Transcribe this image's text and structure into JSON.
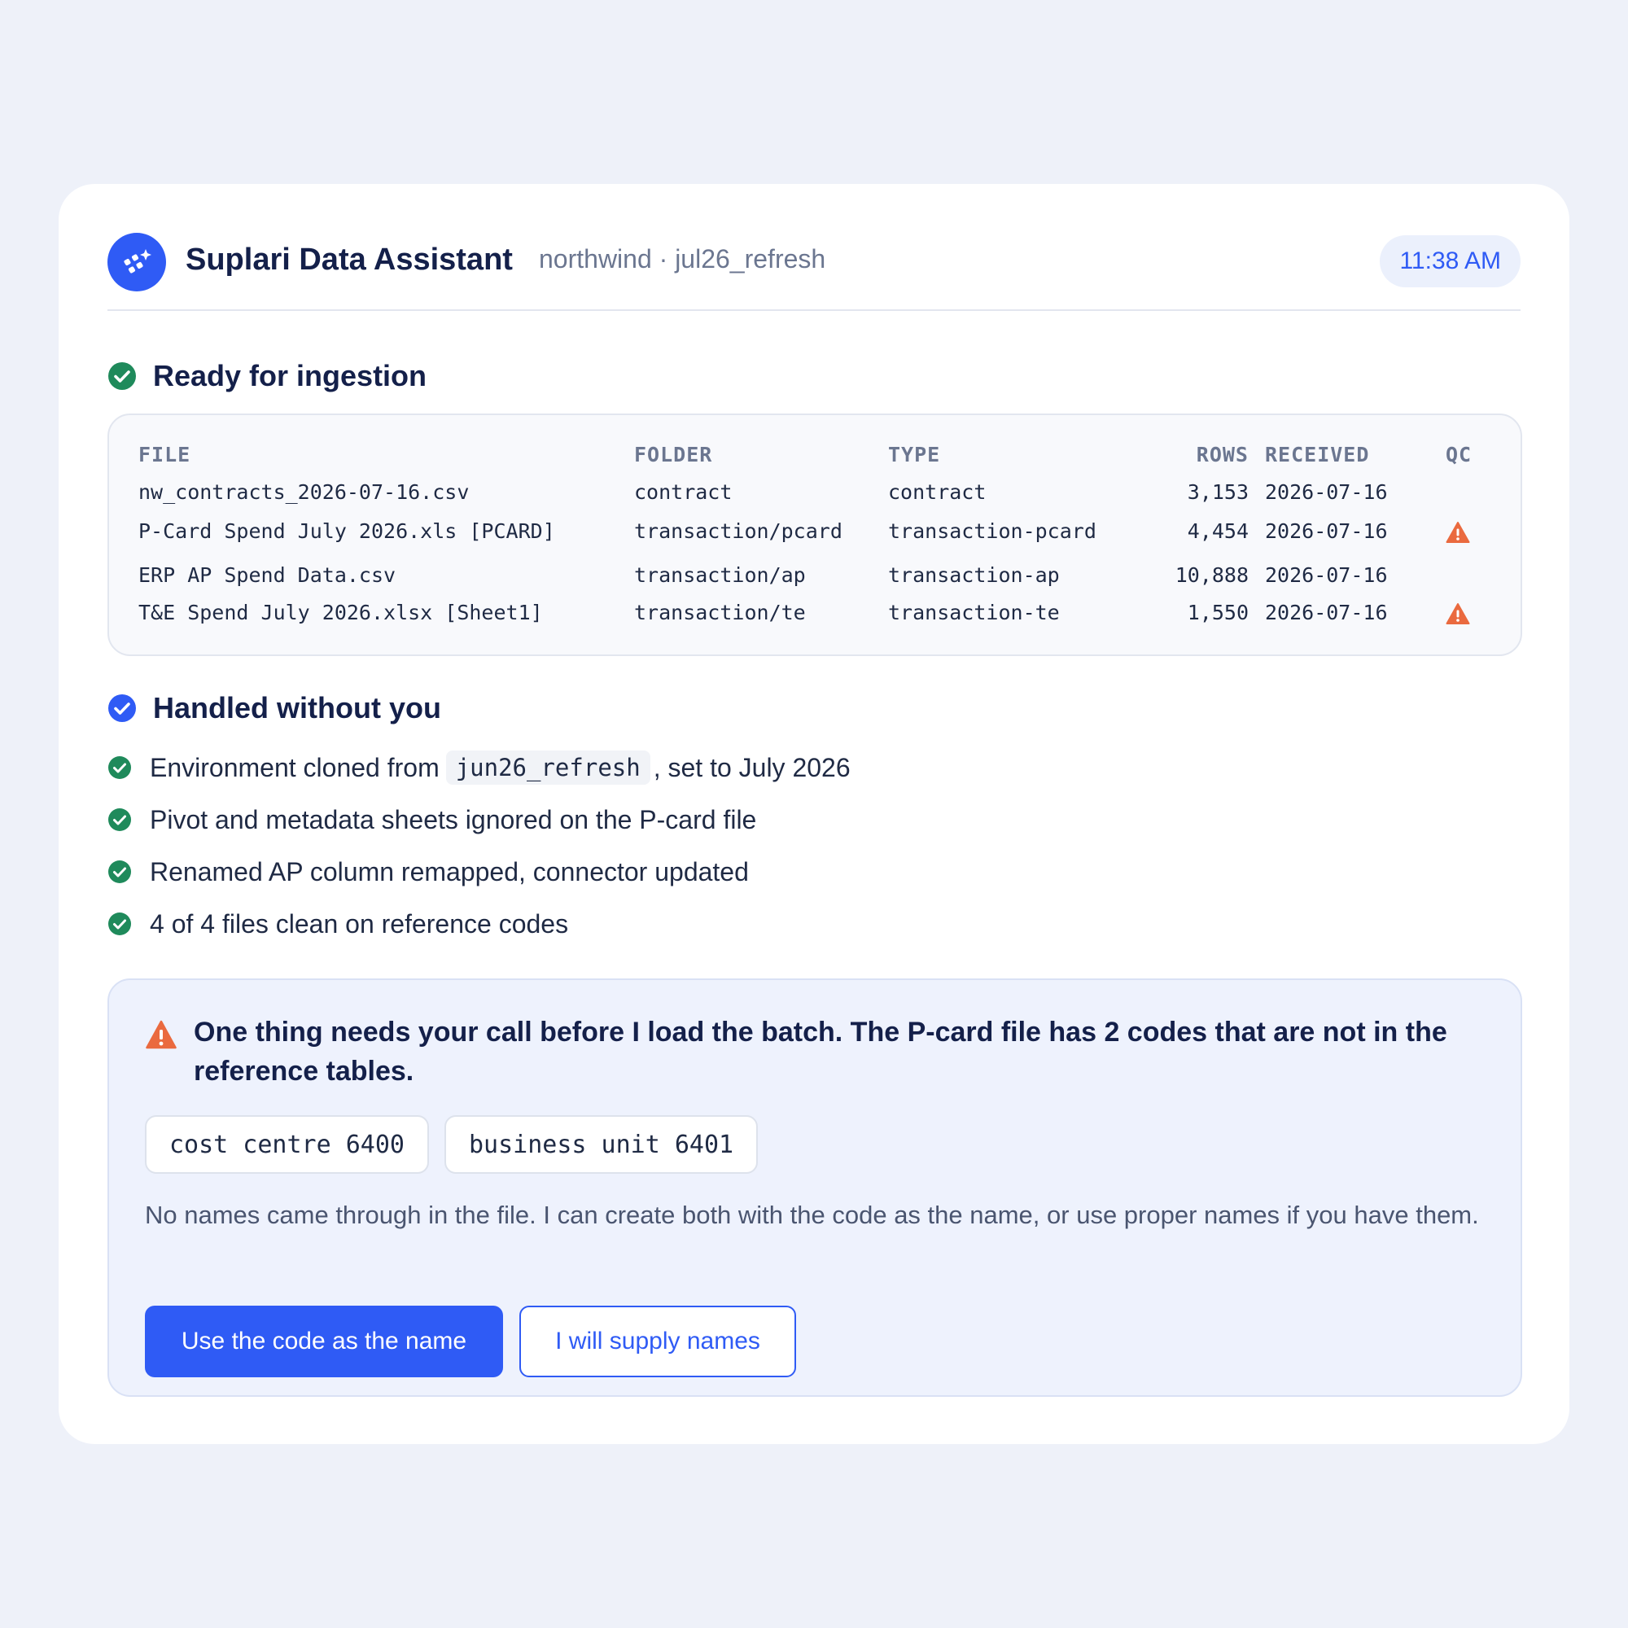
{
  "header": {
    "title": "Suplari Data Assistant",
    "subtitle": "northwind · jul26_refresh",
    "time": "11:38 AM",
    "logo_icon": "sparkle-icon"
  },
  "ready": {
    "heading": "Ready for ingestion",
    "columns": [
      "FILE",
      "FOLDER",
      "TYPE",
      "ROWS",
      "RECEIVED",
      "QC"
    ],
    "rows": [
      {
        "file": "nw_contracts_2026-07-16.csv",
        "folder": "contract",
        "type": "contract",
        "rows": "3,153",
        "received": "2026-07-16",
        "qc_warning": false
      },
      {
        "file": "P-Card Spend July 2026.xls [PCARD]",
        "folder": "transaction/pcard",
        "type": "transaction-pcard",
        "rows": "4,454",
        "received": "2026-07-16",
        "qc_warning": true
      },
      {
        "file": "ERP AP Spend Data.csv",
        "folder": "transaction/ap",
        "type": "transaction-ap",
        "rows": "10,888",
        "received": "2026-07-16",
        "qc_warning": false
      },
      {
        "file": "T&E Spend July 2026.xlsx [Sheet1]",
        "folder": "transaction/te",
        "type": "transaction-te",
        "rows": "1,550",
        "received": "2026-07-16",
        "qc_warning": true
      }
    ]
  },
  "handled": {
    "heading": "Handled without you",
    "items": [
      {
        "text_before": "Environment cloned from",
        "code": "jun26_refresh",
        "text_after": ", set to July 2026"
      },
      {
        "text": "Pivot and metadata sheets ignored on the P-card file"
      },
      {
        "text": "Renamed AP column remapped, connector updated"
      },
      {
        "text": "4 of 4 files clean on reference codes"
      }
    ]
  },
  "callout": {
    "title": "One thing needs your call before I load the batch. The P-card file has 2 codes that are not in the reference tables.",
    "chips": [
      "cost centre 6400",
      "business unit 6401"
    ],
    "body": "No names came through in the file. I can create both with the code as the name, or use proper names if you have them.",
    "primary_button": "Use the code as the name",
    "secondary_button": "I will supply names"
  },
  "colors": {
    "brand": "#2f5bf5",
    "success": "#1f8a5b",
    "warning": "#ea6a3f",
    "background": "#eef1f9"
  }
}
